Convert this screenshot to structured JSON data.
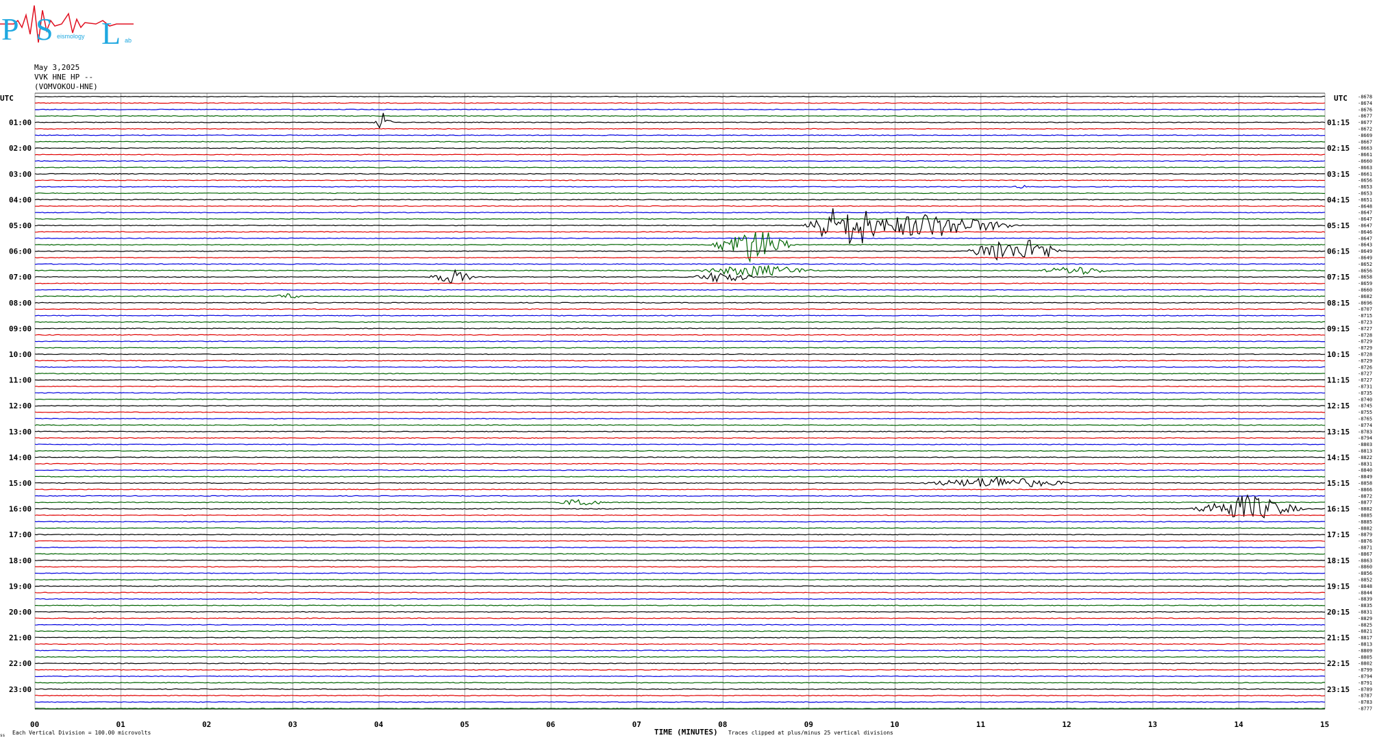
{
  "logo": {
    "letters": [
      "P",
      "S",
      "L"
    ],
    "sub_words": [
      "eismology",
      "ab"
    ]
  },
  "header": {
    "date": "May 3,2025",
    "station": "VVK HNE HP --",
    "site": "(VOMVOKOU-HNE)"
  },
  "footer": {
    "division_note": "Each Vertical Division =  100.00 microvolts",
    "xlabel": "TIME (MINUTES)",
    "clip_note": "Traces clipped at plus/minus 25 vertical divisions",
    "corner_mark": "ss"
  },
  "colors": {
    "trace_cycle": [
      "#000000",
      "#e00000",
      "#0000e0",
      "#006400"
    ],
    "grid": "#808080",
    "logo": "#1fa8e0",
    "logo_wave": "#e01020"
  },
  "chart_data": {
    "type": "helicorder",
    "title": "",
    "xlabel": "TIME (MINUTES)",
    "xlim": [
      0,
      15
    ],
    "x_ticks": [
      "00",
      "01",
      "02",
      "03",
      "04",
      "05",
      "06",
      "07",
      "08",
      "09",
      "10",
      "11",
      "12",
      "13",
      "14",
      "15"
    ],
    "left_axis_label": "UTC",
    "right_axis_label": "UTC",
    "lines_count": 96,
    "minutes_per_line": 15,
    "left_hour_labels": [
      "01:00",
      "02:00",
      "03:00",
      "04:00",
      "05:00",
      "06:00",
      "07:00",
      "08:00",
      "09:00",
      "10:00",
      "11:00",
      "12:00",
      "13:00",
      "14:00",
      "15:00",
      "16:00",
      "17:00",
      "18:00",
      "19:00",
      "20:00",
      "21:00",
      "22:00",
      "23:00"
    ],
    "right_hour_labels": [
      "01:15",
      "02:15",
      "03:15",
      "04:15",
      "05:15",
      "06:15",
      "07:15",
      "08:15",
      "09:15",
      "10:15",
      "11:15",
      "12:15",
      "13:15",
      "14:15",
      "15:15",
      "16:15",
      "17:15",
      "18:15",
      "19:15",
      "20:15",
      "21:15",
      "22:15",
      "23:15"
    ],
    "line_offsets": [
      -8678,
      -8674,
      -8676,
      -8677,
      -8677,
      -8672,
      -8669,
      -8667,
      -8663,
      -8661,
      -8660,
      -8663,
      -8661,
      -8656,
      -8653,
      -8653,
      -8651,
      -8648,
      -8647,
      -8647,
      -8647,
      -8646,
      -8647,
      -8643,
      -8649,
      -8649,
      -8652,
      -8656,
      -8658,
      -8659,
      -8660,
      -8682,
      -8696,
      -8707,
      -8715,
      -8723,
      -8727,
      -8728,
      -8729,
      -8729,
      -8728,
      -8729,
      -8726,
      -8727,
      -8727,
      -8731,
      -8735,
      -8740,
      -8745,
      -8755,
      -8765,
      -8774,
      -8783,
      -8794,
      -8803,
      -8813,
      -8822,
      -8831,
      -8840,
      -8849,
      -8858,
      -8866,
      -8872,
      -8877,
      -8882,
      -8885,
      -8885,
      -8882,
      -8879,
      -8876,
      -8871,
      -8867,
      -8863,
      -8860,
      -8856,
      -8852,
      -8848,
      -8844,
      -8839,
      -8835,
      -8831,
      -8829,
      -8825,
      -8821,
      -8817,
      -8813,
      -8809,
      -8805,
      -8802,
      -8799,
      -8794,
      -8791,
      -8789,
      -8787,
      -8783,
      -8777
    ],
    "events": [
      {
        "line": 4,
        "minute": 4.05,
        "amp": 3.0,
        "dur": 0.12
      },
      {
        "line": 14,
        "minute": 11.45,
        "amp": 1.5,
        "dur": 0.08
      },
      {
        "line": 20,
        "minute": 9.25,
        "amp": 6.0,
        "dur": 0.35
      },
      {
        "line": 20,
        "minute": 9.55,
        "amp": 8.0,
        "dur": 0.35
      },
      {
        "line": 20,
        "minute": 10.35,
        "amp": 4.0,
        "dur": 1.2
      },
      {
        "line": 23,
        "minute": 8.35,
        "amp": 6.0,
        "dur": 0.5
      },
      {
        "line": 24,
        "minute": 11.2,
        "amp": 4.0,
        "dur": 0.4
      },
      {
        "line": 24,
        "minute": 11.6,
        "amp": 4.0,
        "dur": 0.4
      },
      {
        "line": 27,
        "minute": 8.4,
        "amp": 2.0,
        "dur": 0.8
      },
      {
        "line": 27,
        "minute": 12.1,
        "amp": 1.5,
        "dur": 0.5
      },
      {
        "line": 28,
        "minute": 4.85,
        "amp": 2.5,
        "dur": 0.3
      },
      {
        "line": 28,
        "minute": 8.0,
        "amp": 2.0,
        "dur": 0.4
      },
      {
        "line": 31,
        "minute": 2.95,
        "amp": 1.0,
        "dur": 0.2
      },
      {
        "line": 60,
        "minute": 11.2,
        "amp": 2.0,
        "dur": 1.0
      },
      {
        "line": 63,
        "minute": 6.35,
        "amp": 1.5,
        "dur": 0.3
      },
      {
        "line": 64,
        "minute": 14.1,
        "amp": 4.5,
        "dur": 0.7
      }
    ]
  }
}
